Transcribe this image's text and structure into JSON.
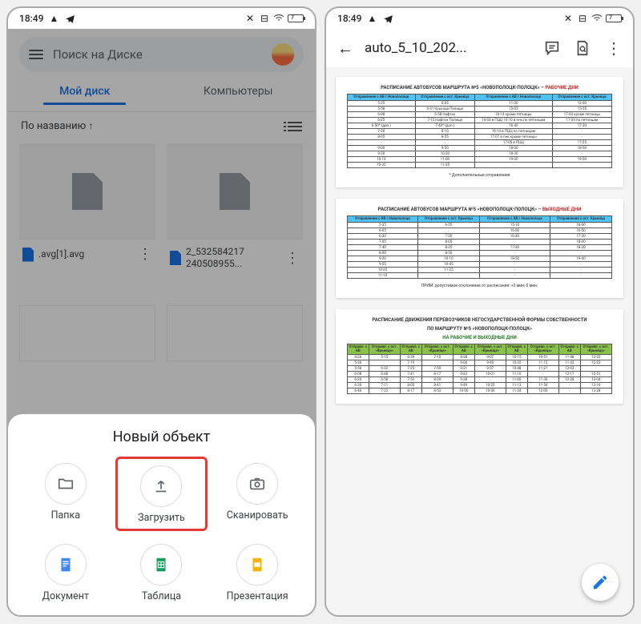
{
  "statusbar": {
    "time": "18:49",
    "battery": "7"
  },
  "left": {
    "search_placeholder": "Поиск на Диске",
    "tabs": {
      "mydisk": "Мой диск",
      "computers": "Компьютеры"
    },
    "sort_label": "По названию",
    "files": [
      {
        "name": ".avg[1].avg"
      },
      {
        "name": "2_532584217\n240508955..."
      }
    ],
    "sheet": {
      "title": "Новый объект",
      "items": {
        "folder": "Папка",
        "upload": "Загрузить",
        "scan": "Сканировать",
        "doc": "Документ",
        "sheet": "Таблица",
        "slide": "Презентация"
      }
    }
  },
  "right": {
    "title": "auto_5_10_202...",
    "page1": {
      "heading": "РАСПИСАНИЕ АВТОБУСОВ МАРШРУТА №5 «НОВОПОЛОЦК-ПОЛОЦК» – ",
      "suffix": "РАБОЧИЕ ДНИ",
      "headers": [
        "Отправление с АВ г.Новополоцк",
        "Отправление с ост. Крынiца",
        "Отправление с АВ г.Новополоцк",
        "Отправление с ост. Крынiца"
      ],
      "rows": [
        [
          "5-35",
          "6-05",
          "11-30",
          "12-00"
        ],
        [
          "5-58",
          "6-41 Крынiца Пелище",
          "15-05",
          "15-55"
        ],
        [
          "6-08",
          "6-58 Нафтан",
          "16-14 кроме пятницы",
          "17-04 кроме пятницы"
        ],
        [
          "6-25",
          "7-15 Нафтан Пелище",
          "16-04 в ПЦЦ 16-10 в пнк по пятницам",
          "17-04 по пятницам"
        ],
        [
          "6-50* (доп.)",
          "7-40* (доп.)",
          "16-40",
          "17-30"
        ],
        [
          "7-20",
          "8-10",
          "16-14 в ПЦЦ по пятницам",
          "-"
        ],
        [
          "8-05",
          "8-55",
          "17-07 в пнк кроме пятницы",
          "-"
        ],
        [
          "-",
          "-",
          "17-05 в ПЦЦ",
          "17-55"
        ],
        [
          "9-00",
          "9-50",
          "18-00",
          "18-50"
        ],
        [
          "9-30",
          "10-20",
          "18-30",
          "-"
        ],
        [
          "10-10",
          "11-00",
          "19-00",
          "19-50"
        ],
        [
          "10-35",
          "11-25",
          "-",
          "-"
        ]
      ],
      "note": "* Дополнительные отправления"
    },
    "page2": {
      "heading": "РАСПИСАНИЕ АВТОБУСОВ МАРШРУТА №5 «НОВОПОЛОЦК-ПОЛОЦК» – ",
      "suffix": "ВЫХОДНЫЕ ДНИ",
      "headers": [
        "Отправление с АВ г.Новополоцк",
        "Отправление с ост. Крынiца",
        "Отправление с АВ г.Новополоцк",
        "Отправление с ост. Крынiца"
      ],
      "rows": [
        [
          "5-35",
          "6-25",
          "15-10",
          "16-00"
        ],
        [
          "6-05",
          "-",
          "16-00",
          "16-50"
        ],
        [
          "6-30",
          "7-20",
          "16-40",
          "17-30"
        ],
        [
          "7-05",
          "8-05",
          "-",
          "18-00"
        ],
        [
          "7-40",
          "8-35",
          "17-30",
          "18-20"
        ],
        [
          "8-00",
          "8-50",
          "-",
          "-"
        ],
        [
          "9-20",
          "10-10",
          "18-50",
          "19-40"
        ],
        [
          "9-55",
          "10-45",
          "-",
          "-"
        ],
        [
          "10-35",
          "11-25",
          "-",
          "-"
        ],
        [
          "11-10",
          "-",
          "-",
          "-"
        ]
      ],
      "note": "ПРИМ: допустимое отклонение от расписания: +3 мин;-5 мин."
    },
    "page3": {
      "heading1": "РАСПИСАНИЕ ДВИЖЕНИЯ ПЕРЕВОЗЧИКОВ НЕГОСУДАРСТВЕННОЙ ФОРМЫ СОБСТВЕННОСТИ",
      "heading2": "ПО МАРШРУТУ №5 «НОВОПОЛОЦК-ПОЛОЦК»",
      "heading3": "НА РАБОЧИЕ И ВЫХОДНЫЕ ДНИ",
      "headers": [
        "Отправл. с АВ",
        "Отправл. с ост. «Крынiца»",
        "Отправл. с АВ",
        "Отправл. с ост. «Крынiца»",
        "Отправл. с АВ",
        "Отправл. с ост. «Крынiца»",
        "Отправл. с АВ",
        "Отправл. с ост. «Крынiца»",
        "Отправл. с АВ",
        "Отправл. с ост. «Крынiца»"
      ],
      "rows": [
        [
          "4-36",
          "5-15",
          "6-39",
          "7-15",
          "8-28",
          "9-07",
          "10-15",
          "10-51",
          "11-48",
          "12-22"
        ],
        [
          "5-36",
          "-",
          "7-19",
          "-",
          "9-04",
          "9-40",
          "10-35",
          "11-12",
          "11-43",
          "12-22"
        ],
        [
          "5-56",
          "6-32",
          "7-25",
          "7-59",
          "9-21",
          "9-57",
          "10-48",
          "11-21",
          "12-03",
          "-"
        ],
        [
          "6-08",
          "6-48",
          "7-41",
          "8-17",
          "9-23",
          "10-01",
          "11-10",
          "-",
          "12-17",
          "12-51"
        ],
        [
          "6-20",
          "6-58",
          "7-53",
          "8-29",
          "9-38",
          "-",
          "11-00",
          "11-36",
          "12-28",
          "13-04"
        ],
        [
          "6-36",
          "7-11",
          "8-05",
          "8-41",
          "9-49",
          "10-25",
          "11-13",
          "11-54",
          "-",
          "13-16"
        ],
        [
          "6-46",
          "7-23",
          "8-17",
          "8-53",
          "10-00",
          "10-36",
          "11-24",
          "12-00",
          "-",
          "13-28"
        ]
      ]
    }
  }
}
